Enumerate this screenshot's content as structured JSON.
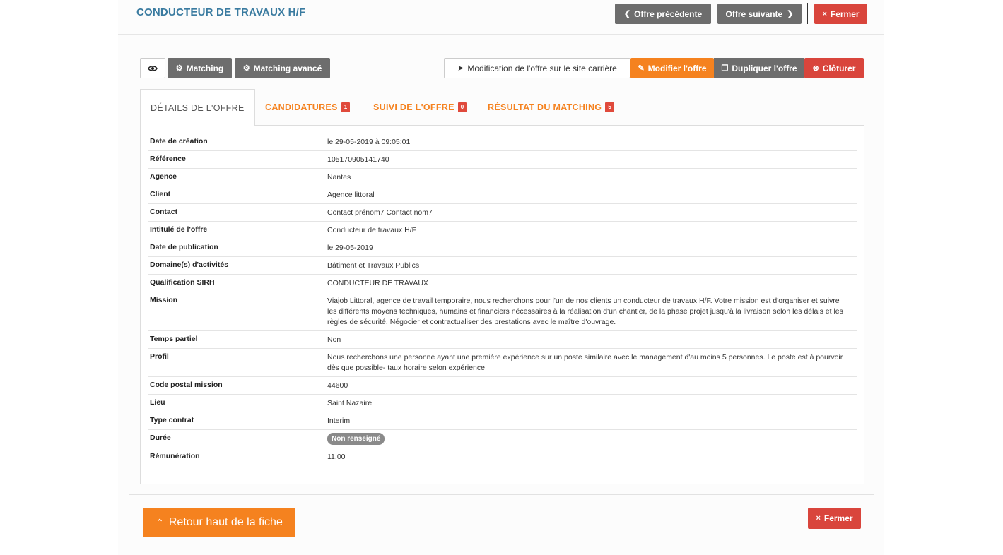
{
  "header": {
    "title": "CONDUCTEUR DE TRAVAUX H/F",
    "prev_label": "Offre précédente",
    "next_label": "Offre suivante",
    "close_label": "Fermer"
  },
  "toolbar": {
    "matching_label": "Matching",
    "matching_advanced_label": "Matching avancé",
    "career_site_label": "Modification de l'offre sur le site carrière",
    "edit_label": "Modifier l'offre",
    "duplicate_label": "Dupliquer l'offre",
    "close_offer_label": "Clôturer"
  },
  "tabs": [
    {
      "label": "DÉTAILS DE L'OFFRE",
      "badge": null,
      "active": true
    },
    {
      "label": "CANDIDATURES",
      "badge": "1",
      "active": false
    },
    {
      "label": "SUIVI DE L'OFFRE",
      "badge": "0",
      "active": false
    },
    {
      "label": "RÉSULTAT DU MATCHING",
      "badge": "5",
      "active": false
    }
  ],
  "details": [
    {
      "label": "Date de création",
      "value": "le 29-05-2019 à 09:05:01"
    },
    {
      "label": "Référence",
      "value": "105170905141740"
    },
    {
      "label": "Agence",
      "value": "Nantes"
    },
    {
      "label": "Client",
      "value": "Agence littoral"
    },
    {
      "label": "Contact",
      "value": "Contact prénom7 Contact nom7"
    },
    {
      "label": "Intitulé de l'offre",
      "value": "Conducteur de travaux H/F"
    },
    {
      "label": "Date de publication",
      "value": "le 29-05-2019"
    },
    {
      "label": "Domaine(s) d'activités",
      "value": "Bâtiment et Travaux Publics"
    },
    {
      "label": "Qualification SIRH",
      "value": "CONDUCTEUR DE TRAVAUX"
    },
    {
      "label": "Mission",
      "value": "Viajob Littoral, agence de travail temporaire, nous recherchons pour l'un de nos clients un conducteur de travaux H/F. Votre mission est d'organiser et suivre les différents moyens techniques, humains et financiers nécessaires à la réalisation d'un chantier, de la phase projet jusqu'à la livraison selon les délais et les règles de sécurité. Négocier et contractualiser des prestations avec le maître d'ouvrage."
    },
    {
      "label": "Temps partiel",
      "value": "Non"
    },
    {
      "label": "Profil",
      "value": "Nous recherchons une personne ayant une première expérience sur un poste similaire avec le management d'au moins 5 personnes. Le poste est à pourvoir dès que possible- taux horaire selon expérience"
    },
    {
      "label": "Code postal mission",
      "value": "44600"
    },
    {
      "label": "Lieu",
      "value": "Saint Nazaire"
    },
    {
      "label": "Type contrat",
      "value": "Interim"
    },
    {
      "label": "Durée",
      "value": "Non renseigné"
    },
    {
      "label": "Rémunération",
      "value": "11.00"
    }
  ],
  "footer": {
    "back_top_label": "Retour haut de la fiche",
    "close_label": "Fermer"
  },
  "icons": {
    "eye": "eye-icon",
    "gear": "gear-icon",
    "send": "paper-plane-icon",
    "edit": "edit-icon",
    "copy": "copy-icon",
    "close_circle": "close-circle-icon",
    "chevron_left": "chevron-left-icon",
    "chevron_right": "chevron-right-icon",
    "chevron_up": "chevron-up-icon",
    "times": "times-icon"
  },
  "colors": {
    "accent": "#f5821f",
    "danger": "#d9453c",
    "neutral": "#6d6d6d",
    "title": "#3a7ba0"
  }
}
